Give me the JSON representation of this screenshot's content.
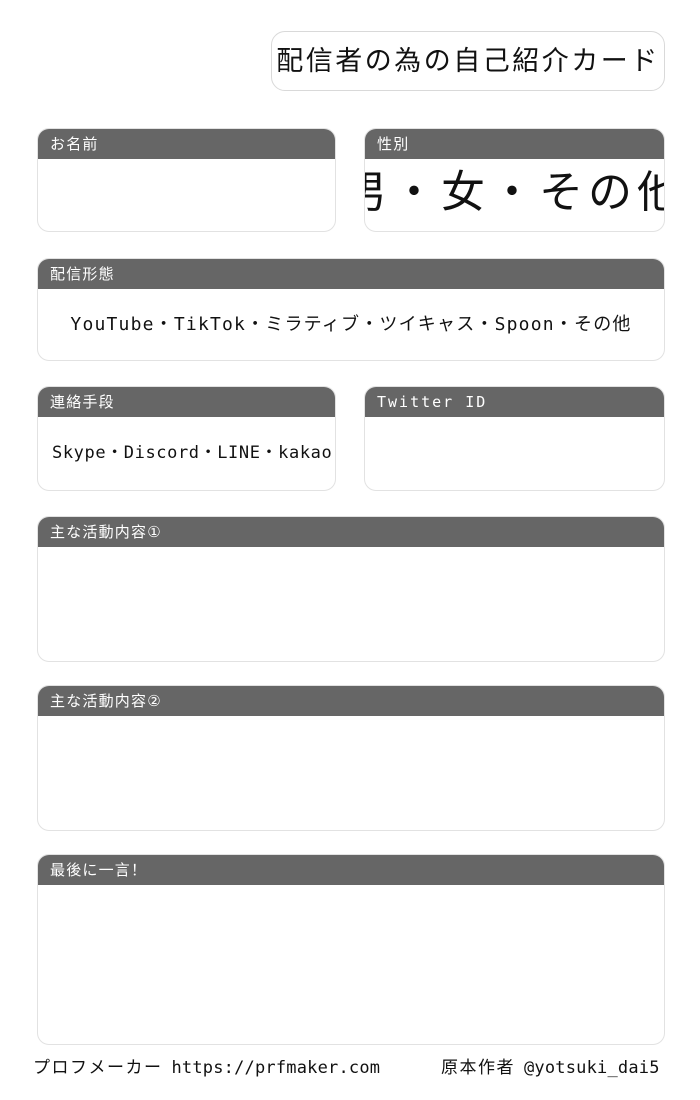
{
  "title": {
    "text": "配信者の為の自己紹介カード"
  },
  "colors": {
    "header_bar": "#666666",
    "header_text": "#ffffff",
    "card_border": "#e2e2e2",
    "background": "#ffffff",
    "body_text": "#111111"
  },
  "fields": {
    "name": {
      "label": "お名前",
      "value": ""
    },
    "gender": {
      "label": "性別",
      "value": "男・女・その他",
      "options": [
        "男",
        "女",
        "その他"
      ]
    },
    "platform": {
      "label": "配信形態",
      "value": "YouTube・TikTok・ミラティブ・ツイキャス・Spoon・その他",
      "options": [
        "YouTube",
        "TikTok",
        "ミラティブ",
        "ツイキャス",
        "Spoon",
        "その他"
      ]
    },
    "contact": {
      "label": "連絡手段",
      "value": "Skype・Discord・LINE・kakao",
      "options": [
        "Skype",
        "Discord",
        "LINE",
        "kakao"
      ]
    },
    "twitter": {
      "label": "Twitter ID",
      "value": ""
    },
    "activity1": {
      "label": "主な活動内容①",
      "value": ""
    },
    "activity2": {
      "label": "主な活動内容②",
      "value": ""
    },
    "last_word": {
      "label": "最後に一言！",
      "value": ""
    }
  },
  "footer": {
    "maker_label": "プロフメーカー",
    "maker_url": "https://prfmaker.com",
    "author_label": "原本作者",
    "author_handle": "@yotsuki_dai5"
  }
}
